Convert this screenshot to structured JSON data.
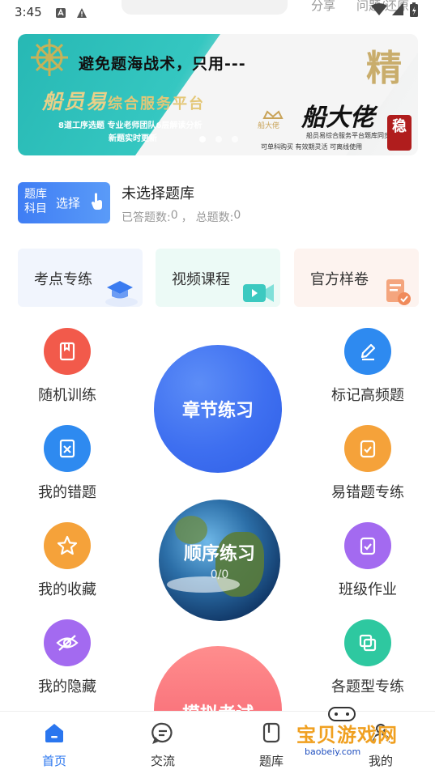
{
  "status_bar": {
    "time": "3:45",
    "share_label": "分享",
    "restore_label": "问题/还原"
  },
  "banner": {
    "headline": "避免题海战术，只用---",
    "brand_left": "船员易",
    "brand_left_suffix": "综合服务平台",
    "sub_line_1": "8道工序选题 专业老师团队6层解读分析",
    "sub_line_2": "新题实时更新",
    "brand_right": "船大佬",
    "logo_small": "船大佬",
    "right_desc_1": "船员易综合服务平台题库同步",
    "right_desc_2": "可单科购买 有效期灵活 可离线使用",
    "jing_char": "精",
    "seal_char": "稳",
    "slide_count": 3,
    "active_slide": 1
  },
  "bank": {
    "button_line1": "题库",
    "button_line2": "科目",
    "button_select": "选择",
    "title": "未选择题库",
    "answered_label": "已答题数:",
    "answered_value": "0",
    "sep": "，",
    "total_label": "总题数:",
    "total_value": "0"
  },
  "cards": [
    {
      "label": "考点专练",
      "icon": "graduation-cap-icon",
      "color": "#3a7bf0"
    },
    {
      "label": "视频课程",
      "icon": "video-camera-icon",
      "color": "#3cc9c0"
    },
    {
      "label": "官方样卷",
      "icon": "document-check-icon",
      "color": "#f08a5a"
    }
  ],
  "grid": {
    "left": [
      {
        "label": "随机训练",
        "icon": "book-icon",
        "color": "#f25a4b"
      },
      {
        "label": "我的错题",
        "icon": "error-book-icon",
        "color": "#2e8af0"
      },
      {
        "label": "我的收藏",
        "icon": "star-icon",
        "color": "#f5a23a"
      },
      {
        "label": "我的隐藏",
        "icon": "eye-off-icon",
        "color": "#a36af0"
      }
    ],
    "right": [
      {
        "label": "标记高频题",
        "icon": "pencil-icon",
        "color": "#2e8af0"
      },
      {
        "label": "易错题专练",
        "icon": "checklist-icon",
        "color": "#f5a23a"
      },
      {
        "label": "班级作业",
        "icon": "assignment-icon",
        "color": "#a36af0"
      },
      {
        "label": "各题型专练",
        "icon": "copy-icon",
        "color": "#2ec8a0"
      }
    ],
    "center": {
      "chapter_label": "章节练习",
      "sequence_label": "顺序练习",
      "sequence_progress": "0/0",
      "mock_label": "模拟考试"
    }
  },
  "bottom_nav": [
    {
      "label": "首页",
      "icon": "home-icon",
      "active": true
    },
    {
      "label": "交流",
      "icon": "chat-icon",
      "active": false
    },
    {
      "label": "题库",
      "icon": "question-bank-icon",
      "active": false
    },
    {
      "label": "我的",
      "icon": "profile-icon",
      "active": false
    }
  ],
  "watermark": {
    "main": "宝贝游戏网",
    "url": "baobeiy.com"
  },
  "colors": {
    "accent": "#2a76ef",
    "bank_button": "#4d8cf6"
  }
}
